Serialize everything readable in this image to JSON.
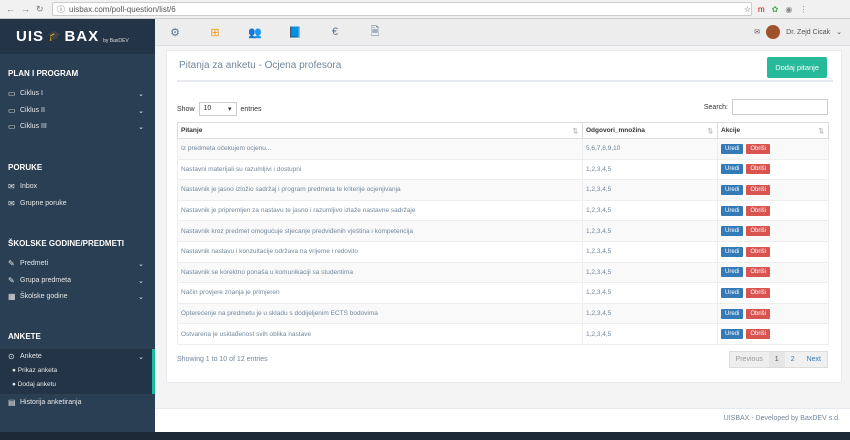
{
  "browser": {
    "url": "uisbax.com/poll-question/list/6"
  },
  "brand": {
    "a": "UIS",
    "b": "BAX",
    "by": "by BaxDEV"
  },
  "sidebar": {
    "s1": "PLAN I PROGRAM",
    "ciklus": [
      "Ciklus I",
      "Ciklus II",
      "Ciklus III"
    ],
    "s2": "PORUKE",
    "inbox": "Inbox",
    "grupne": "Grupne poruke",
    "s3": "ŠKOLSKE GODINE/PREDMETI",
    "predmeti": "Predmeti",
    "grupa": "Grupa predmeta",
    "godine": "Školske godine",
    "s4": "ANKETE",
    "ankete": "Ankete",
    "prikaz": "Prikaz anketa",
    "dodaj": "Dodaj anketu",
    "historija": "Historija anketiranja"
  },
  "user": {
    "name": "Dr. Zejd Cicak"
  },
  "panel": {
    "title": "Pitanja za anketu - Ocjena profesora",
    "add": "Dodaj pitanje"
  },
  "table": {
    "show": "Show",
    "entries_val": "10",
    "entries": "entries",
    "search": "Search:",
    "headers": [
      "Pitanje",
      "Odgovori_množina",
      "Akcije"
    ],
    "edit": "Uredi",
    "del": "Obriši",
    "rows": [
      [
        "Iz predmeta očekujem ocjenu...",
        "5,6,7,8,9,10"
      ],
      [
        "Nastavni materijali su razumljivi i dostupni",
        "1,2,3,4,5"
      ],
      [
        "Nastavnik je jasno izložio sadržaj i program predmeta te kriterije ocjenjivanja",
        "1,2,3,4,5"
      ],
      [
        "Nastavnik je pripremljen za nastavu te jasno i razumljivo izlaže nastavne sadržaje",
        "1,2,3,4,5"
      ],
      [
        "Nastavnik kroz predmet omogućuje stjecanje predviđenih vještina i kompetencija",
        "1,2,3,4,5"
      ],
      [
        "Nastavnik nastavu i konzultacije održava na vrijeme i redovito",
        "1,2,3,4,5"
      ],
      [
        "Nastavnik se korektno ponaša u komunikaciji sa studentima",
        "1,2,3,4,5"
      ],
      [
        "Način provjere znanja je primjeren",
        "1,2,3,4,5"
      ],
      [
        "Opterećenje na predmetu je u skladu s dodijeljenim ECTS bodovima",
        "1,2,3,4,5"
      ],
      [
        "Ostvarena je usklađenost svih oblika nastave",
        "1,2,3,4,5"
      ]
    ],
    "info": "Showing 1 to 10 of 12 entries",
    "prev": "Previous",
    "p1": "1",
    "p2": "2",
    "next": "Next"
  },
  "footer": "UISBAX - Developed by BaxDEV s.d."
}
